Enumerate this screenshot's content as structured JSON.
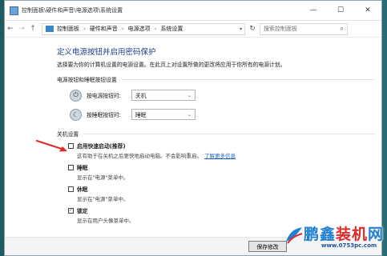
{
  "window": {
    "title": "控制面板\\硬件和声音\\电源选项\\系统设置",
    "controls": {
      "minimize": "—",
      "maximize": "☐",
      "close": "✕"
    }
  },
  "nav": {
    "back": "←",
    "forward": "→",
    "up": "↑",
    "breadcrumbs": [
      "控制面板",
      "硬件和声音",
      "电源选项",
      "系统设置"
    ],
    "search_placeholder": "搜索控制面板"
  },
  "main": {
    "heading": "定义电源按钮并启用密码保护",
    "description": "选择要为你的计算机设置的电源设置。在此页上对设置所做的更改将应用于你所有的电源计划。",
    "power_section": {
      "title": "电源按钮和睡眠按钮设置",
      "rows": [
        {
          "label": "按电源按钮时:",
          "value": "关机",
          "icon": "power-icon"
        },
        {
          "label": "按睡眠按钮时:",
          "value": "睡眠",
          "icon": "sleep-icon"
        }
      ]
    },
    "shutdown_section": {
      "title": "关机设置",
      "fast_startup": {
        "label": "启用快速启动(推荐)",
        "checked": false,
        "desc": "这有助于在关机之后更快地启动电脑。不会影响重启。",
        "link": "了解更多信息"
      },
      "sleep": {
        "label": "睡眠",
        "checked": false,
        "desc": "显示在\"电源\"菜单中。"
      },
      "hibernate": {
        "label": "休眠",
        "checked": false,
        "desc": "显示在\"电源\"菜单中。"
      },
      "lock": {
        "label": "锁定",
        "checked": true,
        "check_glyph": "✓",
        "desc": "显示在用户头像菜单中。"
      }
    },
    "save_button": "保存修改"
  },
  "watermark": {
    "brand_blue": "鹏鑫",
    "brand_red": "装机",
    "brand_blue2": "网",
    "url": "www.0753pc.com"
  },
  "colors": {
    "heading": "#1e3f8c",
    "link": "#1a5fb4",
    "arrow": "#e02a2a"
  }
}
